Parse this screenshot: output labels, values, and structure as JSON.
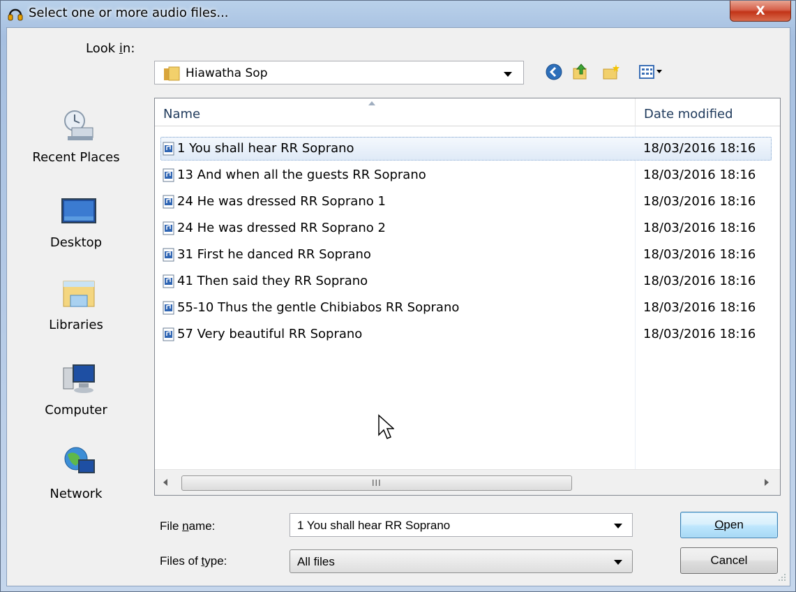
{
  "window": {
    "title": "Select one or more audio files...",
    "close_label": "X"
  },
  "lookin": {
    "label": "Look in:",
    "label_prefix": "Look ",
    "label_hotkey": "i",
    "label_suffix": "n:",
    "folder": "Hiawatha Sop"
  },
  "toolbar": {
    "icons": [
      "back-icon",
      "up-folder-icon",
      "new-folder-icon",
      "view-menu-icon"
    ]
  },
  "places": [
    {
      "label": "Recent Places",
      "icon": "recent-places-icon"
    },
    {
      "label": "Desktop",
      "icon": "desktop-icon"
    },
    {
      "label": "Libraries",
      "icon": "libraries-icon"
    },
    {
      "label": "Computer",
      "icon": "computer-icon"
    },
    {
      "label": "Network",
      "icon": "network-icon"
    }
  ],
  "filelist": {
    "columns": [
      "Name",
      "Date modified"
    ],
    "rows": [
      {
        "name": "1 You shall hear RR Soprano",
        "date": "18/03/2016 18:16",
        "selected": true
      },
      {
        "name": "13 And when all the guests RR Soprano",
        "date": "18/03/2016 18:16"
      },
      {
        "name": "24 He was dressed RR Soprano 1",
        "date": "18/03/2016 18:16"
      },
      {
        "name": "24 He was dressed RR Soprano 2",
        "date": "18/03/2016 18:16"
      },
      {
        "name": "31 First he danced RR Soprano",
        "date": "18/03/2016 18:16"
      },
      {
        "name": "41 Then said they RR Soprano",
        "date": "18/03/2016 18:16"
      },
      {
        "name": "55-10 Thus the gentle Chibiabos RR Soprano",
        "date": "18/03/2016 18:16"
      },
      {
        "name": "57 Very beautiful RR Soprano",
        "date": "18/03/2016 18:16"
      }
    ],
    "scroll_grip": "III"
  },
  "filename": {
    "label_prefix": "File ",
    "label_hotkey": "n",
    "label_suffix": "ame:",
    "value": "1 You shall hear RR Soprano"
  },
  "filetype": {
    "label_prefix": "Files of ",
    "label_hotkey": "t",
    "label_suffix": "ype:",
    "value": "All files"
  },
  "buttons": {
    "open_hotkey": "O",
    "open_rest": "pen",
    "cancel": "Cancel"
  },
  "colors": {
    "selection_border": "#7da2ce",
    "header_text": "#1e395b",
    "close_button": "#c23418"
  }
}
